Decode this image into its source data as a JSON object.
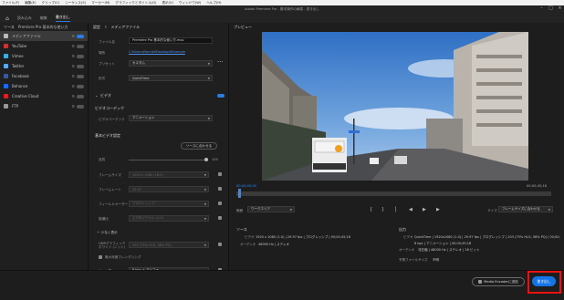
{
  "menubar": [
    "ファイル(F)",
    "編集(E)",
    "クリップ(C)",
    "シーケンス(S)",
    "マーカー(M)",
    "グラフィックとタイトル(G)",
    "表示(V)",
    "ウィンドウ(W)",
    "ヘルプ(H)"
  ],
  "window_title": "Adobe Premiere Pro - 基本操作の練習 - 書き出し",
  "modes": {
    "home_icon": "home-icon",
    "items": [
      "読み込み",
      "編集",
      "書き出し"
    ],
    "active": "書き出し"
  },
  "source_panel": {
    "title": "ソース",
    "project": "Premiere Pro 基本的な使い方",
    "items": [
      {
        "label": "メディアファイル",
        "on": true,
        "selected": true
      },
      {
        "label": "YouTube",
        "on": false
      },
      {
        "label": "Vimeo",
        "on": false
      },
      {
        "label": "Twitter",
        "on": false
      },
      {
        "label": "Facebook",
        "on": false
      },
      {
        "label": "Behance",
        "on": false
      },
      {
        "label": "Creative Cloud",
        "on": false
      },
      {
        "label": "FTP",
        "on": false
      }
    ]
  },
  "settings": {
    "title": "設定",
    "subtitle": "メディアファイル",
    "filename_label": "ファイル名",
    "filename_value": "Premiere Pro 基本的な使い方.mov",
    "location_label": "場所",
    "location_value": "C:¥Users¥tomik¥Desktop¥Example",
    "preset_label": "プリセット",
    "preset_value": "カスタム",
    "format_label": "形式",
    "format_value": "QuickTime",
    "video_section": "ビデオ",
    "codec_section": "ビデオコーデック",
    "codec_label": "ビデオコーデック",
    "codec_value": "アニメーション",
    "basic_section": "基本ビデオ設定",
    "match_source": "ソースに合わせる",
    "quality_label": "品質",
    "quality_value": "100",
    "fields": [
      {
        "label": "フレームサイズ",
        "value": "1920 x 1080 (16:9)"
      },
      {
        "label": "フレームレート",
        "value": "29.97"
      },
      {
        "label": "フィールドオーダー",
        "value": "プログレッシブ"
      },
      {
        "label": "縦横比",
        "value": "正方形ピクセル (1.0)"
      }
    ],
    "more_label": "一 少なく表示",
    "hdr_label": "HDRグラフィックホワイト (ニット)",
    "hdr_value": "203 (75% HLG, 58% PQ)",
    "max_depth": "最大深度でレンダリング",
    "bit_label": "ビット数",
    "bit_value": "8 bpc + アルファ"
  },
  "preview": {
    "title": "プレビュー",
    "tc_start": "00;00;00;00",
    "tc_end": "00;00;45;18",
    "range_label": "範囲",
    "range_value": "ワークエリア",
    "size_label": "サイズ",
    "size_value": "フレームサイズに合わせる",
    "source_heading": "ソース",
    "source_video_label": "ビデオ",
    "source_video_value": "1920 x 1080 (1.0) | 29.97 fps | プログレッシブ | 00;00;45;18",
    "source_audio_label": "オーディオ",
    "source_audio_value": "48000 Hz | ステレオ",
    "output_heading": "出力",
    "output_video_label": "ビデオ",
    "output_video_value": "QuickTime | 1920x1080 (1.0) | 29.97 fps | プログレッシブ | 203 (75% HLG, 58% PQ) | 00;00;45;18",
    "output_video_value2": "8 bpc | アニメーション | 00;00;45;18",
    "output_audio_label": "オーディオ",
    "output_audio_value": "非圧縮 | 48000 Hz | ステレオ | 16 ビット",
    "filesize_label": "予測ファイルサイズ",
    "filesize_value": "不明"
  },
  "bottom": {
    "encoder_label": "Media Encoderに送信",
    "export_label": "書き出し"
  },
  "colors": {
    "accent": "#1473e6",
    "highlight": "#e11111"
  }
}
